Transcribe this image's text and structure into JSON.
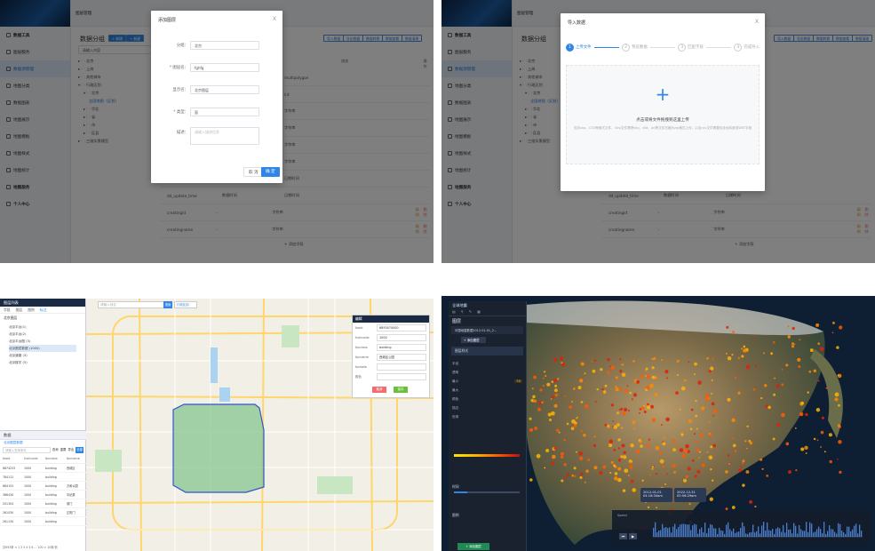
{
  "q1": {
    "header_title": "图层管理",
    "sidebar": {
      "group1": "数据工具",
      "items": [
        "图层服务",
        "数据源管理",
        "地图分类",
        "数据图表",
        "地图展示",
        "地图模板",
        "地图样式",
        "地图统计"
      ],
      "group2": "地图服务",
      "group3": "个人中心"
    },
    "page_title": "数据分组",
    "toolbar": {
      "add": "+ 新增",
      "add2": "+ 新建"
    },
    "right_btns": [
      "导入数据",
      "导出数据",
      "数据转换",
      "数据查看",
      "数据清理"
    ],
    "search_placeholder": "请输入内容",
    "tree": [
      "▸ 🗀 北京",
      "▸ 🗀 上海",
      "▸ 🗀 其他城市",
      "▾ 🗀 行政区划",
      "▾ 🗀 北京",
      "全国地图（区划）",
      "▸ 🗀 华北",
      "▸ 🗀 省",
      "▸ 🗀 市",
      "▸ 🗀 区县",
      "▸ 🗀 三维实景模型"
    ],
    "columns": [
      "",
      "",
      "类型",
      "描述",
      "",
      "操作"
    ],
    "rows": [
      {
        "c3": "multipolygon",
        "c4": "",
        "c5": ""
      },
      {
        "c3": "int",
        "c4": "",
        "c5": ""
      },
      {
        "c3": "字符串",
        "c4": "",
        "c5": ""
      },
      {
        "c3": "字符串",
        "c4": "",
        "c5": ""
      },
      {
        "c3": "字符串",
        "c4": "",
        "c5": ""
      },
      {
        "c3": "字符串",
        "c4": "",
        "c5": ""
      },
      {
        "c3": "日期时间",
        "c4": "",
        "c5": ""
      },
      {
        "c1": "dd_update_time",
        "c2": "数据时间",
        "c3": "日期时间"
      },
      {
        "c1": "creatingid",
        "c2": "-",
        "c3": "字符串"
      },
      {
        "c1": "creatingname",
        "c2": "-",
        "c3": "字符串"
      }
    ],
    "op_edit": "编辑",
    "op_del": "删除",
    "add_field": "+ 添加字段",
    "dialog": {
      "title": "添加图层",
      "close": "X",
      "fields": [
        {
          "label": "分组：",
          "value": "北京",
          "type": "select"
        },
        {
          "label": "* 图层名：",
          "value": "fghfg",
          "type": "input"
        },
        {
          "label": "显示名：",
          "value": "北京图层",
          "type": "input"
        },
        {
          "label": "* 类型：",
          "value": "面",
          "type": "select"
        },
        {
          "label": "描述：",
          "value": "请输入描述信息",
          "type": "textarea"
        }
      ],
      "cancel": "取 消",
      "ok": "确 定"
    }
  },
  "q2": {
    "header_title": "图层管理",
    "page_title": "数据分组",
    "dialog": {
      "title": "导入数据",
      "close": "X",
      "steps": [
        {
          "num": "1",
          "label": "上传文件"
        },
        {
          "num": "2",
          "label": "预览数据"
        },
        {
          "num": "3",
          "label": "匹配字段"
        },
        {
          "num": "4",
          "label": "完成导入"
        }
      ],
      "upload_icon": "+",
      "upload_text": "点击或将文件拖拽到这里上传",
      "upload_hint": "支持shp、CSV等格式文件，Geo文件需把shp、dbf、prj等文件压缩为zip格式上传，以及csv文件需要包含经纬度或WKT字段"
    }
  },
  "q3": {
    "panel_title": "图层列表",
    "tabs": [
      "字段",
      "图层",
      "图例",
      "标注"
    ],
    "tree_root": "北京图层",
    "tree_items": [
      "北京平台(1)",
      "北京平台(2)",
      "北京平台图 (3)",
      "北京图层数据 (1000)",
      "北京道路 (3)",
      "北京楼宇 (5)"
    ],
    "search_placeholder": "请输入地名",
    "search_btn": "搜索",
    "map_dropdown": "行政区划",
    "popup": {
      "title": "编辑",
      "fields": [
        {
          "k": "fooid",
          "v": "6893470000"
        },
        {
          "k": "fcaircode",
          "v": "1000"
        },
        {
          "k": "fpcclass",
          "v": "building"
        },
        {
          "k": "fpcname",
          "v": "西城区公园"
        },
        {
          "k": "fpcdate",
          "v": ""
        },
        {
          "k": "颜色",
          "v": ""
        }
      ],
      "btn_cancel": "取消",
      "btn_ok": "保存"
    },
    "data_title": "数据",
    "data_tab": "北京图层数据",
    "filter_placeholder": "请输入查询条件",
    "data_btns": [
      "查询",
      "重置",
      "导出",
      "全部"
    ],
    "data_columns": [
      "fooid",
      "fcaircode",
      "fpcclass",
      "fpcname"
    ],
    "data_rows": [
      [
        "6874233",
        "1000",
        "building",
        "西城区"
      ],
      [
        "784112",
        "1000",
        "building",
        ""
      ],
      [
        "684153",
        "1000",
        "building",
        "万和公园"
      ],
      [
        "386430",
        "1000",
        "building",
        "中纪委"
      ],
      [
        "201304",
        "1000",
        "building",
        "德门"
      ],
      [
        "261030",
        "1000",
        "building",
        "正阳门"
      ],
      [
        "261130",
        "1000",
        "building",
        ""
      ]
    ],
    "pagination": "共993条  < 1 2 3 4 5 6 ... 100 >  10条/页"
  },
  "q4": {
    "app_title": "全球地震",
    "layer_title": "图层",
    "layer_item": "中国地震数据2012-01-01_2...",
    "add_btn": "+ 添加图层",
    "section_style": "图层样式",
    "labels": [
      "半径",
      "透明",
      "最小",
      "最大",
      "颜色",
      "描边",
      "色带"
    ],
    "values": [
      "",
      "",
      "50",
      "",
      "",
      "",
      ""
    ],
    "slider_vals": [
      "100%",
      "1",
      "2"
    ],
    "section_time": "时间",
    "time_start": "2012-01-01 04:16:34am",
    "time_end": "2022-12-31 05:56:29am",
    "timeline_label": "Speed",
    "timeline_btns": [
      "⏮",
      "▶"
    ],
    "legend_title": "图例",
    "bottom_btn": "+ 添加图层"
  },
  "colors": {
    "primary": "#2f86e8",
    "danger": "#f56c6c",
    "warning": "#e6a23c",
    "success": "#67c23a",
    "quake_low": "#ffb400",
    "quake_high": "#e0200a"
  }
}
